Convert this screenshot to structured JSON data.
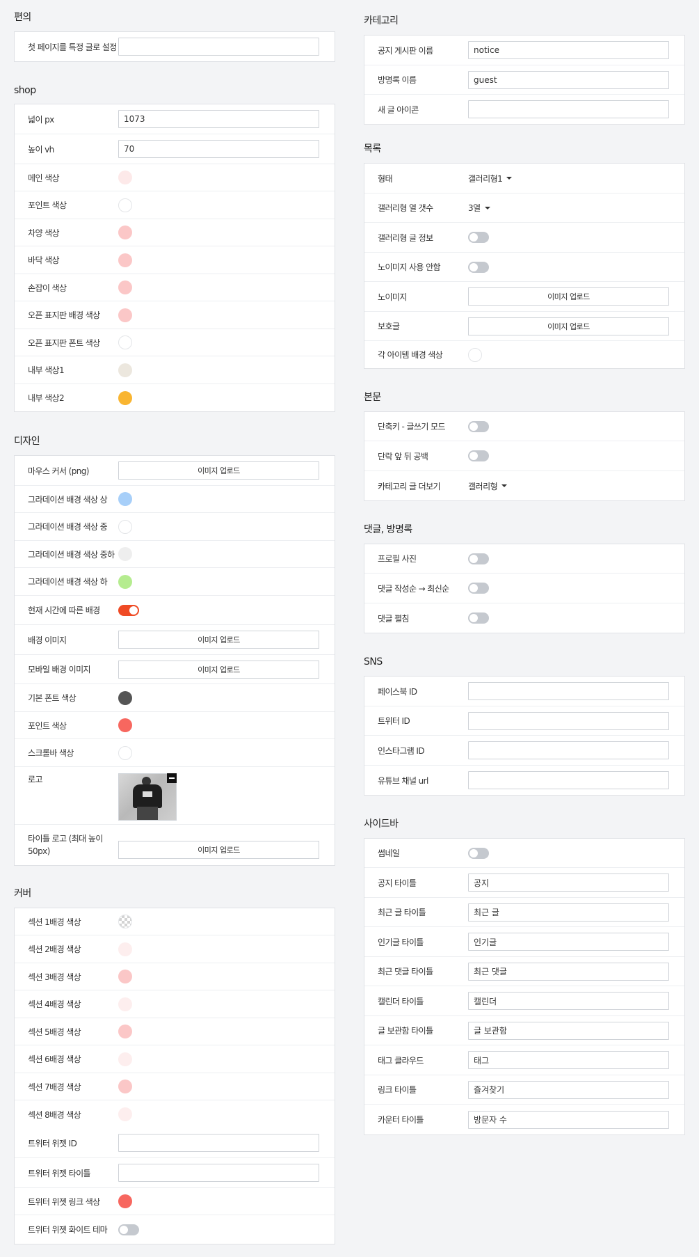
{
  "left": {
    "convenience": {
      "title": "편의",
      "first_page_label": "첫 페이지를 특정 글로 설정",
      "first_page_value": ""
    },
    "shop": {
      "title": "shop",
      "width_label": "넓이 px",
      "width_value": "1073",
      "height_label": "높이 vh",
      "height_value": "70",
      "colors": [
        {
          "label": "메인 색상",
          "color": "#fde9e9"
        },
        {
          "label": "포인트 색상",
          "color": "#ffffff"
        },
        {
          "label": "차양 색상",
          "color": "#fbc7c7"
        },
        {
          "label": "바닥 색상",
          "color": "#fbc7c7"
        },
        {
          "label": "손잡이 색상",
          "color": "#fbc7c7"
        },
        {
          "label": "오픈 표지판 배경 색상",
          "color": "#fbc7c7"
        },
        {
          "label": "오픈 표지판 폰트 색상",
          "color": "#ffffff"
        },
        {
          "label": "내부 색상1",
          "color": "#ece7de"
        },
        {
          "label": "내부 색상2",
          "color": "#f9b531"
        }
      ]
    },
    "design": {
      "title": "디자인",
      "cursor_label": "마우스 커서 (png)",
      "cursor_button": "이미지 업로드",
      "grad_top_label": "그라데이션 배경 색상 상",
      "grad_top_color": "#a7cff9",
      "grad_mid_label": "그라데이션 배경 색상 중",
      "grad_mid_color": "#ffffff",
      "grad_midlow_label": "그라데이션 배경 색상 중하",
      "grad_midlow_color": "#eeeeee",
      "grad_low_label": "그라데이션 배경 색상 하",
      "grad_low_color": "#b5ec8f",
      "time_bg_label": "현재 시간에 따른 배경",
      "time_bg_on": true,
      "bg_image_label": "배경 이미지",
      "bg_image_button": "이미지 업로드",
      "mobile_bg_label": "모바일 배경 이미지",
      "mobile_bg_button": "이미지 업로드",
      "font_color_label": "기본 폰트 색상",
      "font_color": "#555555",
      "point_color_label": "포인트 색상",
      "point_color": "#f7675f",
      "scrollbar_label": "스크롤바 색상",
      "scrollbar_color": "#ffffff",
      "logo_label": "로고",
      "title_logo_label": "타이틀 로고 (최대 높이 50px)",
      "title_logo_button": "이미지 업로드"
    },
    "cover": {
      "title": "커버",
      "sections": [
        {
          "label": "섹션 1배경 색상",
          "color": "transparent"
        },
        {
          "label": "섹션 2배경 색상",
          "color": "#fdeeee"
        },
        {
          "label": "섹션 3배경 색상",
          "color": "#fbc7c7"
        },
        {
          "label": "섹션 4배경 색상",
          "color": "#fdeeee"
        },
        {
          "label": "섹션 5배경 색상",
          "color": "#fbc7c7"
        },
        {
          "label": "섹션 6배경 색상",
          "color": "#fdeeee"
        },
        {
          "label": "섹션 7배경 색상",
          "color": "#fbc7c7"
        },
        {
          "label": "섹션 8배경 색상",
          "color": "#fdeeee"
        }
      ],
      "twitter_id_label": "트위터 위젯 ID",
      "twitter_id_value": "",
      "twitter_title_label": "트위터 위젯 타이틀",
      "twitter_title_value": "",
      "twitter_link_label": "트위터 위젯 링크 색상",
      "twitter_link_color": "#f7675f",
      "twitter_white_label": "트위터 위젯 화이트 테마",
      "twitter_white_on": false
    }
  },
  "right": {
    "category": {
      "title": "카테고리",
      "notice_label": "공지 게시판 이름",
      "notice_value": "notice",
      "guest_label": "방명록 이름",
      "guest_value": "guest",
      "newpost_label": "새 글 아이콘",
      "newpost_value": ""
    },
    "list": {
      "title": "목록",
      "type_label": "형태",
      "type_value": "갤러리형1",
      "columns_label": "갤러리형 열 갯수",
      "columns_value": "3열",
      "gallery_info_label": "갤러리형 글 정보",
      "noimage_off_label": "노이미지 사용 안함",
      "noimage_label": "노이미지",
      "noimage_button": "이미지 업로드",
      "protected_label": "보호글",
      "protected_button": "이미지 업로드",
      "item_bg_label": "각 아이템 배경 색상",
      "item_bg_color": "#ffffff"
    },
    "body": {
      "title": "본문",
      "shortcut_label": "단축키 - 글쓰기 모드",
      "paragraph_label": "단락 앞 뒤 공백",
      "more_label": "카테고리 글 더보기",
      "more_value": "갤러리형"
    },
    "comments": {
      "title": "댓글, 방명록",
      "profile_label": "프로필 사진",
      "order_label": "댓글 작성순 → 최신순",
      "expand_label": "댓글 펼침"
    },
    "sns": {
      "title": "SNS",
      "fields": [
        {
          "label": "페이스북 ID",
          "value": ""
        },
        {
          "label": "트위터 ID",
          "value": ""
        },
        {
          "label": "인스타그램 ID",
          "value": ""
        },
        {
          "label": "유튜브 채널 url",
          "value": ""
        }
      ]
    },
    "sidebar": {
      "title": "사이드바",
      "thumbnail_label": "썸네일",
      "fields": [
        {
          "label": "공지 타이틀",
          "value": "공지"
        },
        {
          "label": "최근 글 타이틀",
          "value": "최근 글"
        },
        {
          "label": "인기글 타이틀",
          "value": "인기글"
        },
        {
          "label": "최근 댓글 타이틀",
          "value": "최근 댓글"
        },
        {
          "label": "캘린더 타이틀",
          "value": "캘린더"
        },
        {
          "label": "글 보관함 타이틀",
          "value": "글 보관함"
        },
        {
          "label": "태그 클라우드",
          "value": "태그"
        },
        {
          "label": "링크 타이틀",
          "value": "즐겨찾기"
        },
        {
          "label": "카운터 타이틀",
          "value": "방문자 수"
        }
      ]
    }
  }
}
